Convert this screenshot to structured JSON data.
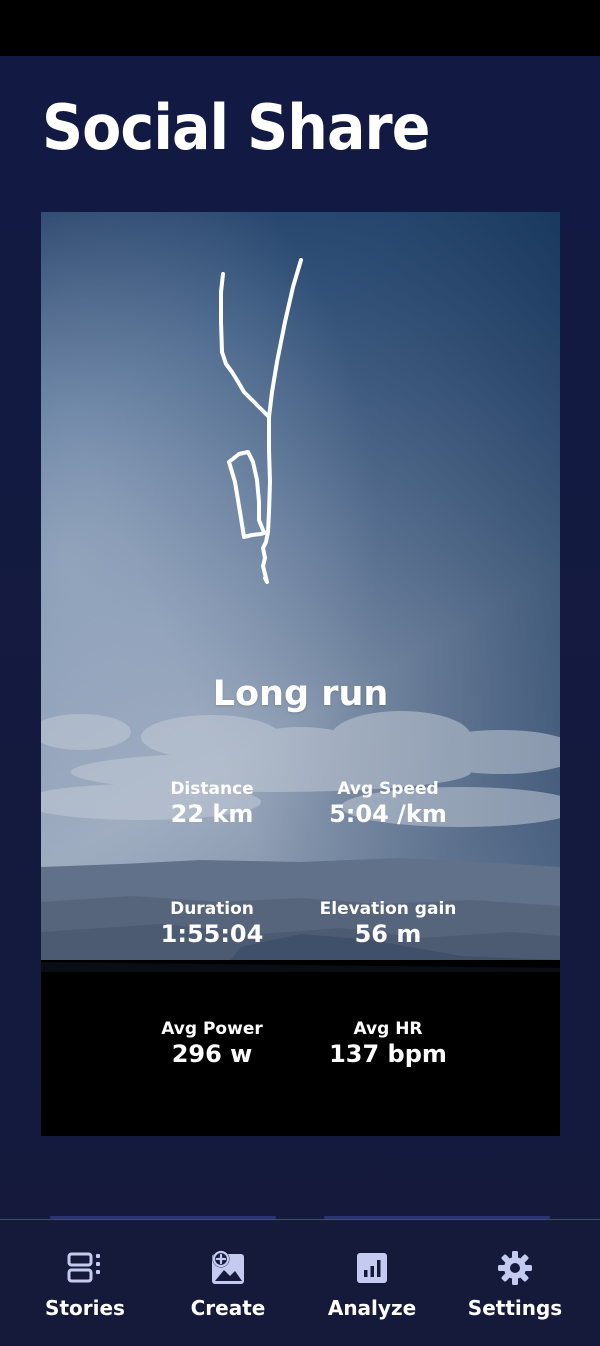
{
  "page": {
    "title": "Social Share"
  },
  "card": {
    "activity_title": "Long run",
    "stats": [
      {
        "label": "Distance",
        "value": "22 km"
      },
      {
        "label": "Avg Speed",
        "value": "5:04 /km"
      },
      {
        "label": "Duration",
        "value": "1:55:04"
      },
      {
        "label": "Elevation gain",
        "value": "56 m"
      },
      {
        "label": "Avg Power",
        "value": "296 w"
      },
      {
        "label": "Avg HR",
        "value": "137 bpm"
      }
    ]
  },
  "nav": {
    "items": [
      {
        "label": "Stories",
        "icon": "stories-icon"
      },
      {
        "label": "Create",
        "icon": "create-image-icon"
      },
      {
        "label": "Analyze",
        "icon": "analyze-chart-icon"
      },
      {
        "label": "Settings",
        "icon": "gear-icon"
      }
    ]
  },
  "colors": {
    "background": "#141a3e",
    "nav_background": "#161a3a",
    "icon_tint": "#c5cbf0",
    "text": "#ffffff"
  }
}
